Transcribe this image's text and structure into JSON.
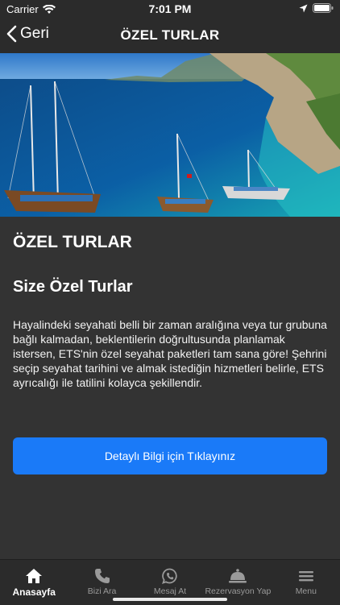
{
  "status_bar": {
    "carrier": "Carrier",
    "time": "7:01 PM"
  },
  "nav": {
    "back_label": "Geri",
    "title": "ÖZEL TURLAR"
  },
  "content": {
    "heading": "ÖZEL TURLAR",
    "subheading": "Size Özel Turlar",
    "description": "Hayalindeki seyahati belli bir zaman aralığına veya tur grubuna bağlı kalmadan, beklentilerin doğrultusunda planlamak istersen, ETS'nin özel seyahat paketleri tam sana göre! Şehrini seçip seyahat tarihini ve almak istediğin hizmetleri belirle, ETS ayrıcalığı ile tatilini kolayca şekillendir."
  },
  "cta": {
    "label": "Detaylı Bilgi için Tıklayınız",
    "color": "#1a7af8"
  },
  "tabs": [
    {
      "label": "Anasayfa",
      "icon": "home-icon",
      "active": true
    },
    {
      "label": "Bizi Ara",
      "icon": "phone-icon",
      "active": false
    },
    {
      "label": "Mesaj At",
      "icon": "whatsapp-icon",
      "active": false
    },
    {
      "label": "Rezervasyon Yap",
      "icon": "bell-icon",
      "active": false
    },
    {
      "label": "Menu",
      "icon": "hamburger-icon",
      "active": false
    }
  ]
}
